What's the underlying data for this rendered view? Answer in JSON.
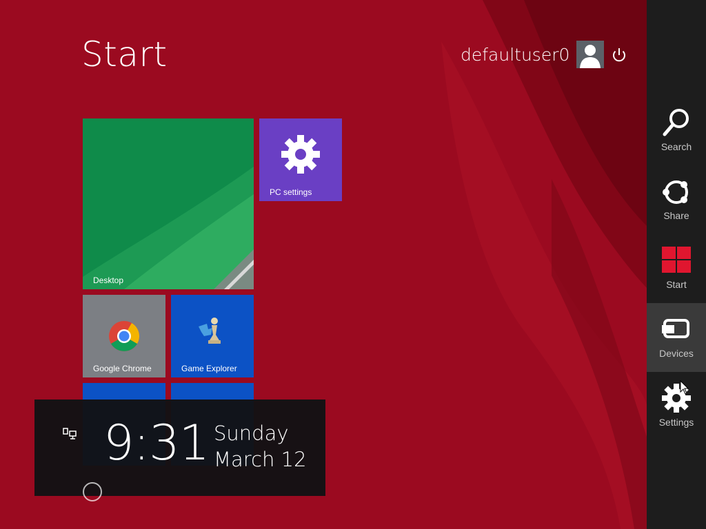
{
  "screen": {
    "title": "Start"
  },
  "user": {
    "name": "defaultuser0",
    "avatar_icon": "user-silhouette-icon",
    "power_icon": "power-icon"
  },
  "tiles": [
    {
      "label": "Desktop",
      "color": "#0f8b4a"
    },
    {
      "label": "PC settings",
      "color": "#6a3fc4",
      "icon": "gear-icon"
    },
    {
      "label": "Google Chrome",
      "color": "#7c7f84",
      "icon": "chrome-icon"
    },
    {
      "label": "Game Explorer",
      "color": "#0c52c5",
      "icon": "game-explorer-icon"
    }
  ],
  "clock": {
    "time": "9:31",
    "day": "Sunday",
    "date": "March 12",
    "network_icon": "network-icon"
  },
  "charms": [
    {
      "label": "Search",
      "icon": "search-icon"
    },
    {
      "label": "Share",
      "icon": "share-icon"
    },
    {
      "label": "Start",
      "icon": "windows-logo-icon"
    },
    {
      "label": "Devices",
      "icon": "devices-icon",
      "active": true
    },
    {
      "label": "Settings",
      "icon": "gear-icon"
    }
  ],
  "colors": {
    "background": "#9b0a20",
    "charms_bar": "#1d1d1d",
    "start_logo": "#e0162f"
  }
}
